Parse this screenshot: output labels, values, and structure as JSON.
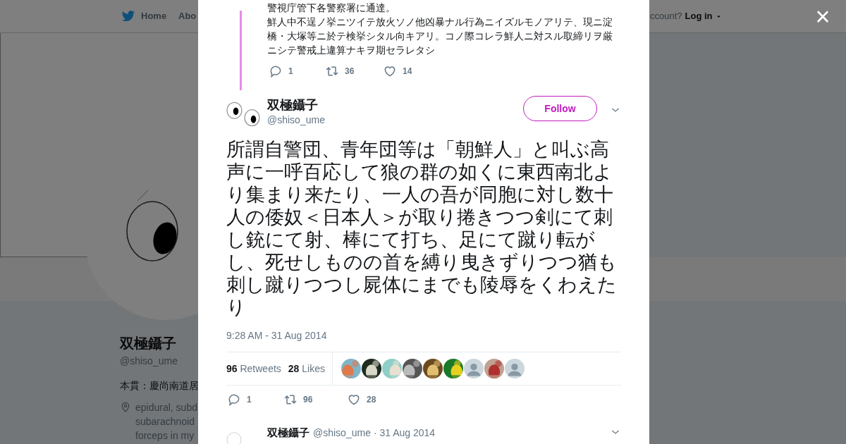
{
  "background_page": {
    "nav": {
      "items": [
        {
          "label": "Home",
          "kind": "bird"
        },
        {
          "label": "Abo",
          "kind": "plain"
        }
      ],
      "account_prompt": "ccount?",
      "login_link": "Log in"
    },
    "profile": {
      "name": "双極鑷子",
      "handle": "@shiso_ume",
      "bio": "本貫：慶尚南道居",
      "location_lines": [
        "epidural, subd",
        "subarachnoid",
        "forceps in my"
      ]
    }
  },
  "modal": {
    "close_label": "×",
    "parent_tweet": {
      "first_line": "警視庁管下各警察署に通達。",
      "lines": [
        "鮮人中不逞ノ挙ニツイテ放火ソノ他凶暴ナル行為ニイズルモノアリテ、現ニ淀",
        "橋・大塚等ニ於テ検挙シタル向キアリ。コノ際コレラ鮮人ニ対スル取締リヲ厳",
        "ニシテ警戒上違算ナキヲ期セラレタシ"
      ],
      "actions": [
        {
          "kind": "reply",
          "count": "1"
        },
        {
          "kind": "retweet",
          "count": "36"
        },
        {
          "kind": "like",
          "count": "14"
        }
      ]
    },
    "tweet": {
      "name": "双極鑷子",
      "handle": "@shiso_ume",
      "follow_label": "Follow",
      "lines": [
        "所謂自警団、青年団等は「朝鮮人」と叫ぶ高",
        "声に一呼百応して狼の群の如くに東西南北よ",
        "り集まり来たり、一人の吾が同胞に対し数十",
        "人の倭奴＜日本人＞が取り捲きつつ剣にて刺",
        "し銃にて射、棒にて打ち、足にて蹴り転が",
        "し、死せしものの首を縛り曳きずりつつ猶も",
        "刺し蹴りつつし屍体にまでも陵辱をくわえた",
        "り"
      ],
      "timestamp": "9:28 AM - 31 Aug 2014",
      "stats": [
        {
          "count": "96",
          "label": "Retweets"
        },
        {
          "count": "28",
          "label": "Likes"
        }
      ],
      "liker_avatars": [
        {
          "kind": "picture"
        },
        {
          "kind": "picture"
        },
        {
          "kind": "picture"
        },
        {
          "kind": "picture"
        },
        {
          "kind": "picture"
        },
        {
          "kind": "picture"
        },
        {
          "kind": "default"
        },
        {
          "kind": "picture"
        },
        {
          "kind": "default"
        }
      ],
      "actions": [
        {
          "kind": "reply",
          "count": "1"
        },
        {
          "kind": "retweet",
          "count": "96"
        },
        {
          "kind": "like",
          "count": "28"
        }
      ]
    },
    "next_tweet": {
      "name": "双極鑷子",
      "handle": "@shiso_ume",
      "date": "· 31 Aug 2014"
    }
  }
}
